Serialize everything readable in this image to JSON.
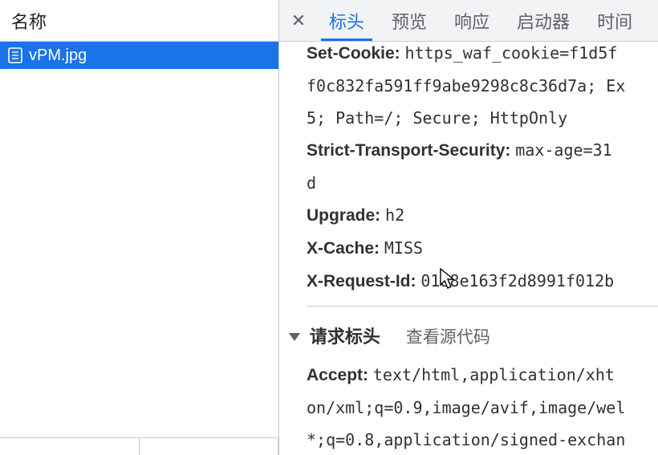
{
  "left": {
    "header": "名称",
    "file": "vPM.jpg"
  },
  "tabs": {
    "t0": "标头",
    "t1": "预览",
    "t2": "响应",
    "t3": "启动器",
    "t4": "时间"
  },
  "response_headers": {
    "set_cookie_k": "Set-Cookie:",
    "set_cookie_v": "https_waf_cookie=f1d5f",
    "set_cookie_c1": "f0c832fa591ff9abe9298c8c36d7a; Ex",
    "set_cookie_c2": "5; Path=/; Secure; HttpOnly",
    "sts_k": "Strict-Transport-Security:",
    "sts_v": "max-age=31",
    "sts_c1": "d",
    "upgrade_k": "Upgrade:",
    "upgrade_v": "h2",
    "xcache_k": "X-Cache:",
    "xcache_v": "MISS",
    "xreq_k": "X-Request-Id:",
    "xreq_v": "0188e163f2d8991f012b"
  },
  "request_section": {
    "title": "请求标头",
    "view_source": "查看源代码",
    "accept_k": "Accept:",
    "accept_v": "text/html,application/xht",
    "accept_c1": "on/xml;q=0.9,image/avif,image/wel",
    "accept_c2": "*;q=0.8,application/signed-exchan"
  }
}
